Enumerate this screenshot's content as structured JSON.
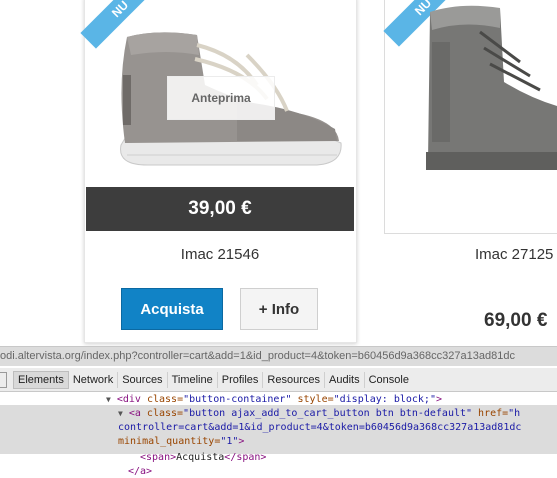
{
  "products": [
    {
      "badge": "NU",
      "image_alt": "Grey suede high-top sneaker",
      "preview_label": "Anteprima",
      "price": "39,00 €",
      "name": "Imac 21546",
      "buy_label": "Acquista",
      "info_label": "+ Info"
    },
    {
      "badge": "NU",
      "image_alt": "Grey padded winter boot",
      "name": "Imac 27125",
      "price": "69,00 €"
    }
  ],
  "colors": {
    "accent": "#1183c6",
    "ribbon": "#5ab5e6",
    "price_bar": "#3d3d3d"
  },
  "url_tooltip": "odi.altervista.org/index.php?controller=cart&add=1&id_product=4&token=b60456d9a368cc327a13ad81dc",
  "devtools": {
    "tabs": [
      "Elements",
      "Network",
      "Sources",
      "Timeline",
      "Profiles",
      "Resources",
      "Audits",
      "Console"
    ],
    "active_tab": "Elements",
    "code": {
      "l1_open": "<div ",
      "l1_attr1": "class=",
      "l1_val1": "\"button-container\"",
      "l1_attr2": " style=",
      "l1_val2": "\"display: block;\"",
      "l1_close": ">",
      "l2_open": "<a ",
      "l2_attr1": "class=",
      "l2_val1": "\"button ajax_add_to_cart_button btn btn-default\"",
      "l2_attr2": " href=",
      "l2_val2": "\"h",
      "l3_val": "controller=cart&add=1&id_product=4&token=b60456d9a368cc327a13ad81dc",
      "l4_attr": "minimal_quantity=",
      "l4_val": "\"1\"",
      "l4_close": ">",
      "l5_open": "<span>",
      "l5_text": "Acquista",
      "l5_close": "</span>",
      "l6_close": "</a>"
    }
  }
}
